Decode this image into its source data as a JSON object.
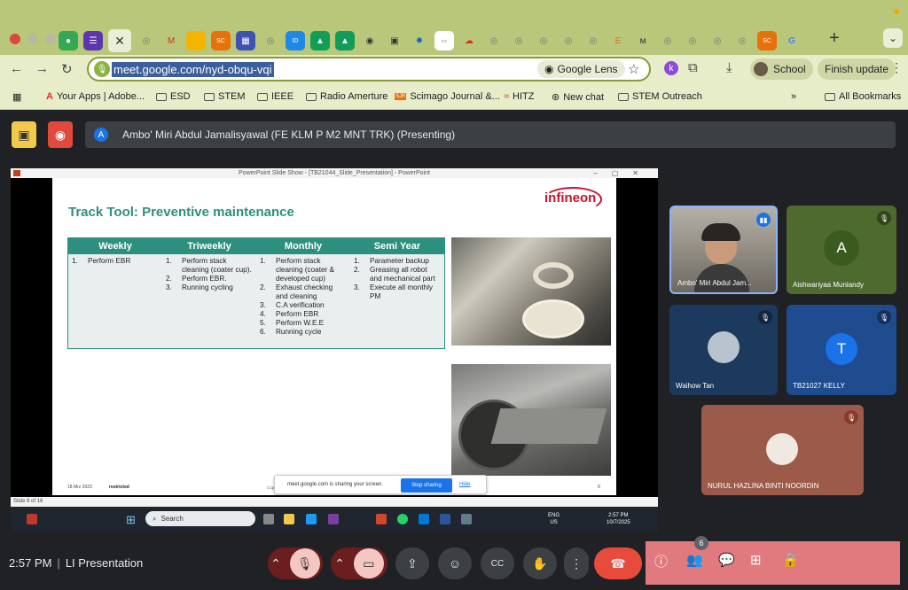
{
  "browser": {
    "url": "meet.google.com/nyd-obqu-vqi",
    "lens_label": "Google Lens",
    "profile_label": "School",
    "finish_update_label": "Finish update",
    "extension_initial": "k"
  },
  "bookmarks": [
    {
      "label": "Your Apps | Adobe..."
    },
    {
      "label": "ESD"
    },
    {
      "label": "STEM"
    },
    {
      "label": "IEEE"
    },
    {
      "label": "Radio Amerture"
    },
    {
      "label": "Scimago Journal &..."
    },
    {
      "label": "HITZ"
    },
    {
      "label": "New chat"
    },
    {
      "label": "STEM Outreach"
    },
    {
      "label": "All Bookmarks"
    }
  ],
  "presenting": {
    "initial": "A",
    "text": "Ambo' Miri Abdul Jamalisyawal (FE KLM P M2 MNT TRK) (Presenting)"
  },
  "ppt": {
    "window_title": "PowerPoint Slide Show - [TB21044_Slide_Presentation] - PowerPoint",
    "status": "Slide 9 of 16",
    "slide": {
      "title": "Track Tool: Preventive maintenance",
      "logo": "infineon",
      "headers": [
        "Weekly",
        "Triweekly",
        "Monthly",
        "Semi Year"
      ],
      "weekly": [
        "Perform EBR"
      ],
      "triweekly": [
        "Perform stack cleaning (coater cup).",
        "Perform EBR.",
        "Running cycling"
      ],
      "monthly": [
        "Perform stack cleaning (coater & developed cup)",
        "Exhaust checking and cleaning",
        "C.A verification",
        "Perform EBR",
        "Perform W.E.E",
        "Running cycle"
      ],
      "semiyear": [
        "Parameter backup",
        "Greasing all robot and mechanical part",
        "Execute all monthly PM"
      ],
      "footer_date": "18 Mrz 2023",
      "footer_restricted": "restricted",
      "footer_copyright": "Copyright © Infineon Technologies AG 2023. All rights reserved.",
      "footer_page": "9"
    },
    "share_toast": {
      "message": "meet.google.com is sharing your screen.",
      "stop": "Stop sharing",
      "hide": "Hide"
    }
  },
  "windows_taskbar": {
    "search_placeholder": "Search",
    "lang": "ENG",
    "region": "US",
    "time": "2:57 PM",
    "date": "10/7/2025"
  },
  "participants": [
    {
      "name": "Ambo' Miri Abdul Jam...",
      "state": "speaking"
    },
    {
      "name": "Aishwariyaa Muniandy",
      "initial": "A",
      "state": "muted",
      "avatar_color": "#3b5a1e"
    },
    {
      "name": "Waihow Tan",
      "state": "muted"
    },
    {
      "name": "TB21027 KELLY",
      "initial": "T",
      "state": "muted",
      "avatar_color": "#1a73e8"
    },
    {
      "name": "NURUL HAZLINA BINTI NOORDIN",
      "state": "muted"
    }
  ],
  "bottom": {
    "time": "2:57 PM",
    "meeting_name": "LI Presentation",
    "participant_count": "6"
  },
  "colors": {
    "tabstrip": "#b8c77a",
    "accent_teal": "#2d8f7f",
    "end_call": "#e64b3c",
    "panel_pink": "#e07a7e"
  }
}
